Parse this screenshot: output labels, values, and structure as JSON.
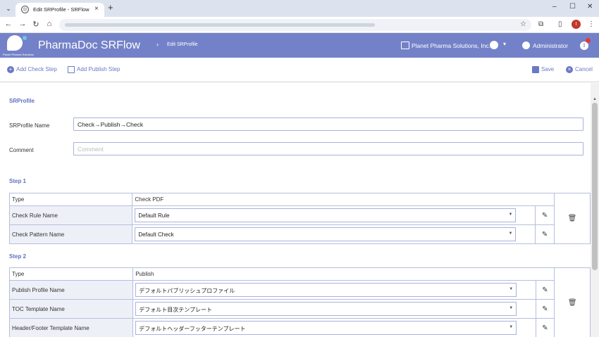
{
  "browser": {
    "tab_title": "Edit SRProfile - SRFlow",
    "tab_favicon": "globe-icon",
    "icons": [
      "chevron-down-icon",
      "close-icon",
      "plus-icon",
      "minimize-icon",
      "maximize-icon",
      "back-icon",
      "forward-icon",
      "reload-icon",
      "home-icon",
      "star-icon",
      "extensions-icon",
      "sidepanel-icon",
      "menu-icon"
    ],
    "profile_initial": "I"
  },
  "header": {
    "logo_text": "Planet Pharma Solutions",
    "app_title": "PharmaDoc SRFlow",
    "breadcrumb_sep": "›",
    "breadcrumb": "Edit SRProfile",
    "company": "Planet Pharma Solutions, Inc.",
    "admin": "Administrator",
    "info": "i",
    "user_caret": "▾"
  },
  "toolbar": {
    "add_check_step": "Add Check Step",
    "add_publish_step": "Add Publish Step",
    "save": "Save",
    "cancel": "Cancel"
  },
  "form": {
    "section_title": "SRProfile",
    "name_label": "SRProfile Name",
    "name_value": "Check→Publish→Check",
    "comment_label": "Comment",
    "comment_placeholder": "Comment"
  },
  "steps": [
    {
      "title": "Step 1",
      "type_label": "Type",
      "type_value": "Check PDF",
      "rows": [
        {
          "label": "Check Rule Name",
          "value": "Default Rule"
        },
        {
          "label": "Check Pattern Name",
          "value": "Default Check"
        }
      ]
    },
    {
      "title": "Step 2",
      "type_label": "Type",
      "type_value": "Publish",
      "rows": [
        {
          "label": "Publish Profile Name",
          "value": "デフォルトパブリッシュプロファイル"
        },
        {
          "label": "TOC Template Name",
          "value": "デフォルト目次テンプレート"
        },
        {
          "label": "Header/Footer Template Name",
          "value": "デフォルトヘッダーフッターテンプレート"
        }
      ]
    }
  ],
  "colors": {
    "accent": "#7382c8",
    "link": "#6b78c4",
    "border": "#b7bedf"
  }
}
